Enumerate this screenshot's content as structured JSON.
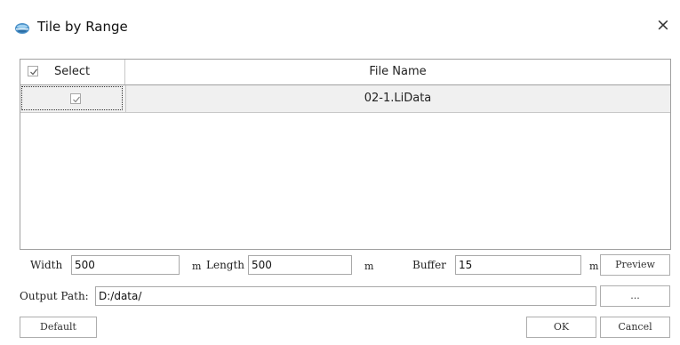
{
  "window": {
    "title": "Tile by Range",
    "close_glyph": "×",
    "app_icon": "app-globe-icon"
  },
  "grid": {
    "columns": [
      "Select",
      "File Name"
    ],
    "header_select_checked": true,
    "rows": [
      {
        "checked": true,
        "file_name": "02-1.LiData"
      }
    ]
  },
  "form": {
    "width_label": "Width",
    "width_value": "500",
    "width_unit": "m",
    "length_label": "Length",
    "length_value": "500",
    "length_unit": "m",
    "buffer_label": "Buffer",
    "buffer_value": "15",
    "buffer_unit": "m",
    "preview_label": "Preview",
    "output_path_label": "Output Path:",
    "output_path_value": "D:/data/",
    "browse_label": "...",
    "default_label": "Default",
    "ok_label": "OK",
    "cancel_label": "Cancel"
  }
}
